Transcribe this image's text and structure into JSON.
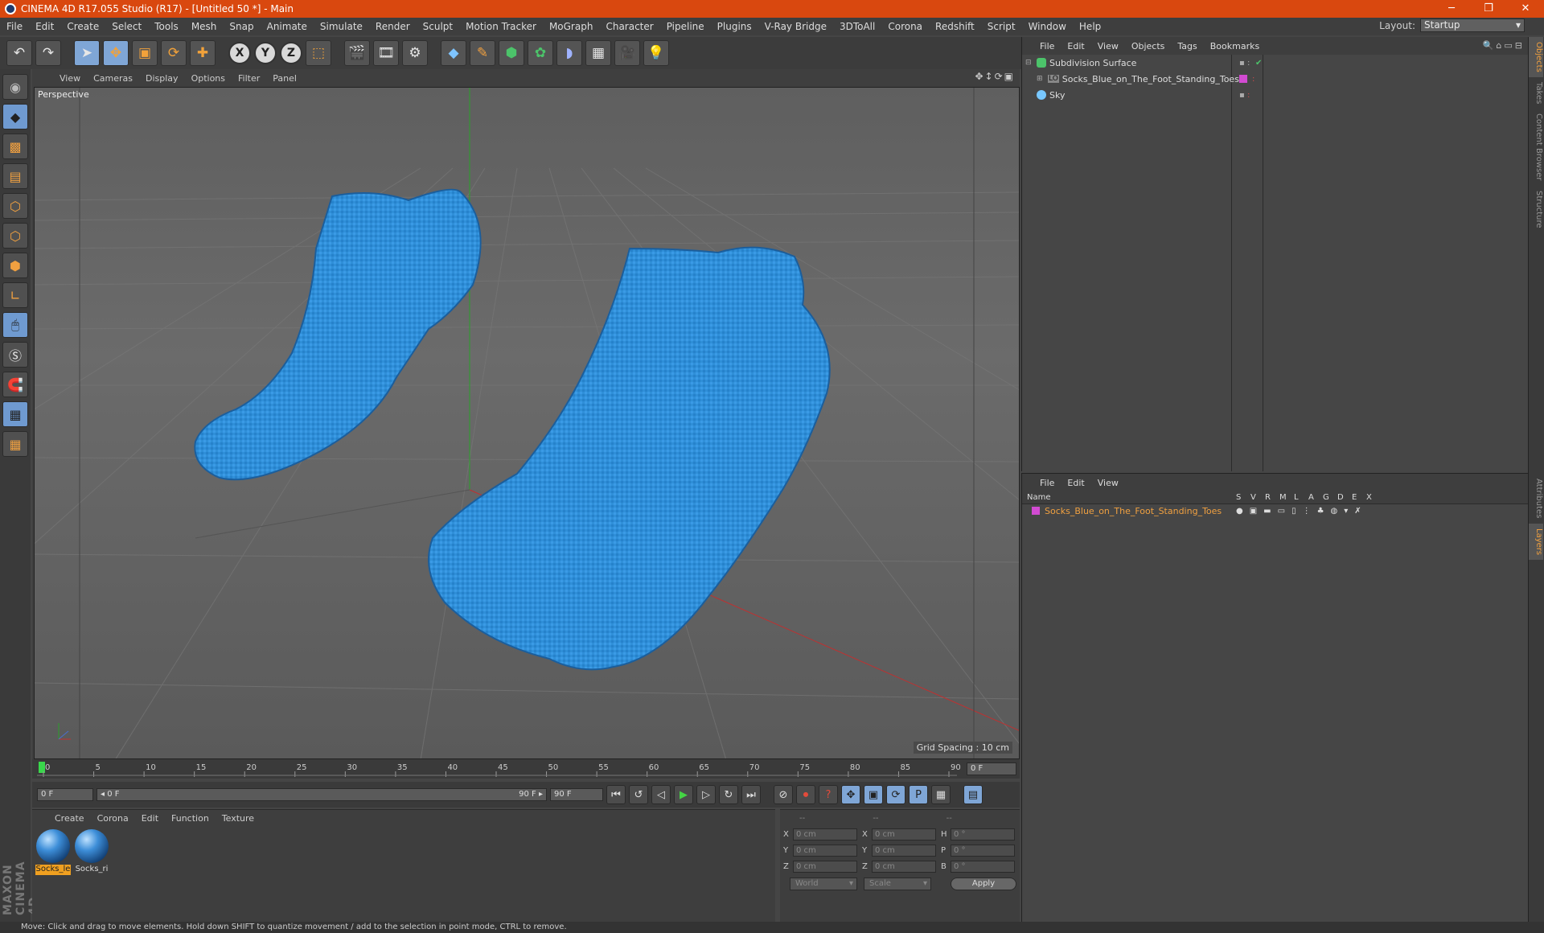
{
  "window": {
    "title": "CINEMA 4D R17.055 Studio (R17) - [Untitled 50 *] - Main",
    "controls": [
      "─",
      "❐",
      "✕"
    ]
  },
  "menubar": [
    "File",
    "Edit",
    "Create",
    "Select",
    "Tools",
    "Mesh",
    "Snap",
    "Animate",
    "Simulate",
    "Render",
    "Sculpt",
    "Motion Tracker",
    "MoGraph",
    "Character",
    "Pipeline",
    "Plugins",
    "V-Ray Bridge",
    "3DToAll",
    "Corona",
    "Redshift",
    "Script",
    "Window",
    "Help"
  ],
  "layout": {
    "label": "Layout:",
    "value": "Startup"
  },
  "viewport": {
    "menu": [
      "View",
      "Cameras",
      "Display",
      "Options",
      "Filter",
      "Panel"
    ],
    "label": "Perspective",
    "grid_spacing": "Grid Spacing : 10 cm",
    "nav_icons": "✥↕⟳▣"
  },
  "timeline": {
    "ticks": [
      "0",
      "5",
      "10",
      "15",
      "20",
      "25",
      "30",
      "35",
      "40",
      "45",
      "50",
      "55",
      "60",
      "65",
      "70",
      "75",
      "80",
      "85",
      "90"
    ],
    "current_frame": "0 F"
  },
  "transport": {
    "start": "0 F",
    "range_start": "◂ 0 F",
    "range_end": "90 F ▸",
    "end": "90 F"
  },
  "materials": {
    "menu": [
      "Create",
      "Corona",
      "Edit",
      "Function",
      "Texture"
    ],
    "items": [
      {
        "label": "Socks_le",
        "selected": true
      },
      {
        "label": "Socks_ri",
        "selected": false
      }
    ]
  },
  "coords": {
    "headers": [
      "--",
      "--",
      "--"
    ],
    "rows": [
      {
        "a1": "X",
        "v1": "0 cm",
        "a2": "X",
        "v2": "0 cm",
        "a3": "H",
        "v3": "0 °"
      },
      {
        "a1": "Y",
        "v1": "0 cm",
        "a2": "Y",
        "v2": "0 cm",
        "a3": "P",
        "v3": "0 °"
      },
      {
        "a1": "Z",
        "v1": "0 cm",
        "a2": "Z",
        "v2": "0 cm",
        "a3": "B",
        "v3": "0 °"
      }
    ],
    "space": "World",
    "mode": "Scale",
    "apply": "Apply"
  },
  "objects": {
    "menu": [
      "File",
      "Edit",
      "View",
      "Objects",
      "Tags",
      "Bookmarks"
    ],
    "items": [
      {
        "name": "Subdivision Surface"
      },
      {
        "name": "Socks_Blue_on_The_Foot_Standing_Toes"
      },
      {
        "name": "Sky"
      }
    ]
  },
  "layers": {
    "menu": [
      "File",
      "Edit",
      "View"
    ],
    "name_header": "Name",
    "columns": [
      "S",
      "V",
      "R",
      "M",
      "L",
      "A",
      "G",
      "D",
      "E",
      "X"
    ],
    "items": [
      {
        "name": "Socks_Blue_on_The_Foot_Standing_Toes"
      }
    ]
  },
  "sidetabs": [
    "Objects",
    "Takes",
    "Content Browser",
    "Structure",
    "Attributes",
    "Layers"
  ],
  "maxon": "MAXON CINEMA 4D",
  "status": "Move: Click and drag to move elements. Hold down SHIFT to quantize movement / add to the selection in point mode, CTRL to remove.",
  "colors": {
    "titlebar": "#d9480f",
    "sock": "#2f8fd8",
    "accent": "#f0a040"
  }
}
